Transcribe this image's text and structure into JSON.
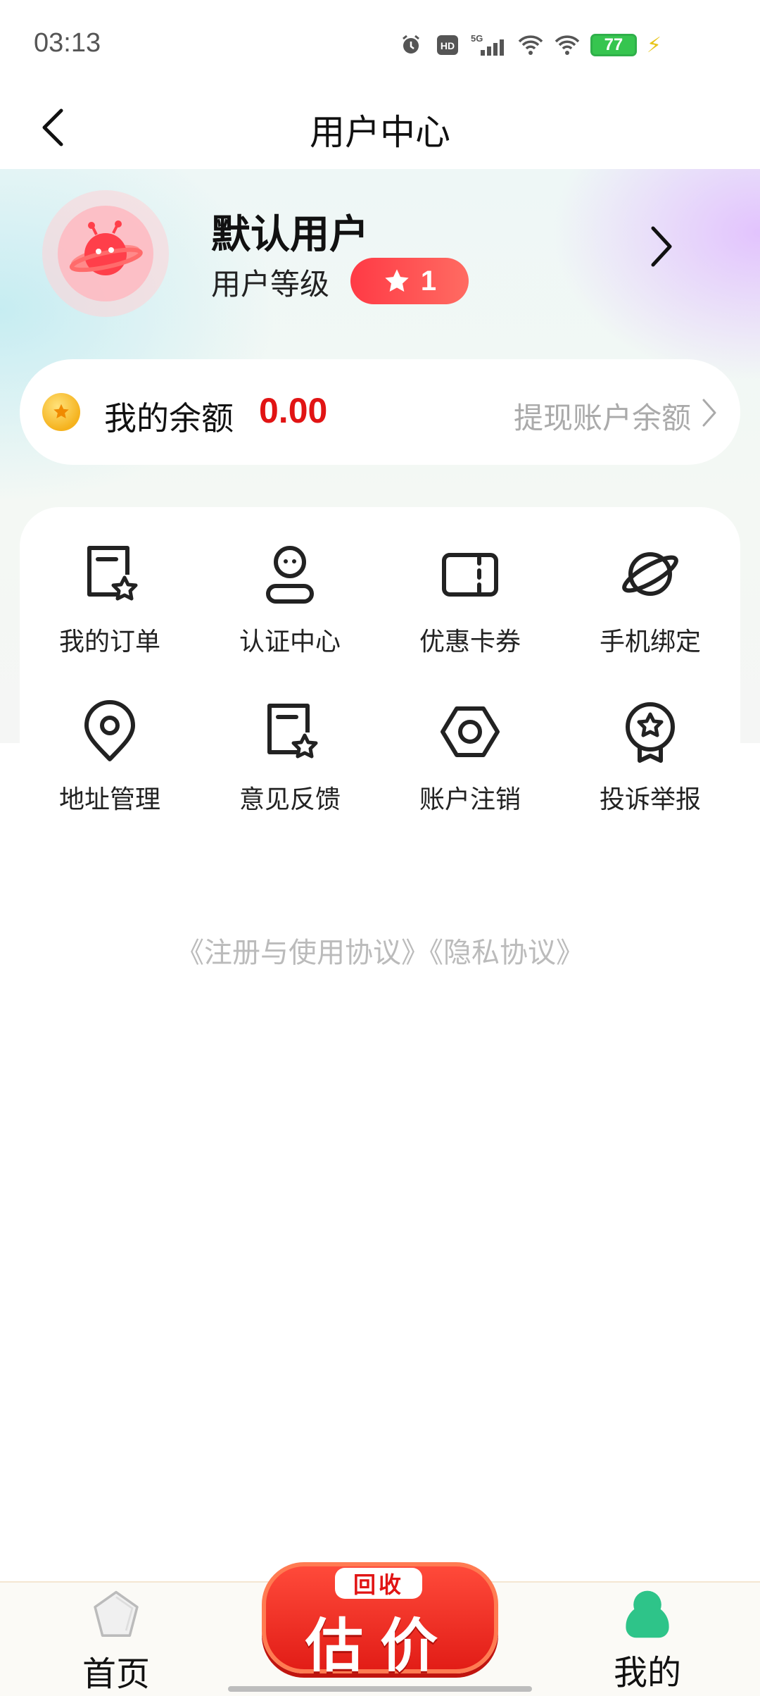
{
  "status_bar": {
    "time": "03:13",
    "network": "5G",
    "battery": "77"
  },
  "header": {
    "title": "用户中心"
  },
  "profile": {
    "name": "默认用户",
    "level_label": "用户等级",
    "level": "1"
  },
  "balance": {
    "label": "我的余额",
    "amount": "0.00",
    "withdraw_label": "提现账户余额"
  },
  "menu": {
    "items": [
      {
        "label": "我的订单",
        "icon": "order-star-icon"
      },
      {
        "label": "认证中心",
        "icon": "person-icon"
      },
      {
        "label": "优惠卡券",
        "icon": "ticket-icon"
      },
      {
        "label": "手机绑定",
        "icon": "planet-icon"
      },
      {
        "label": "地址管理",
        "icon": "location-pin-icon"
      },
      {
        "label": "意见反馈",
        "icon": "feedback-star-icon"
      },
      {
        "label": "账户注销",
        "icon": "hexagon-nut-icon"
      },
      {
        "label": "投诉举报",
        "icon": "award-badge-icon"
      }
    ]
  },
  "agreements": "《注册与使用协议》《隐私协议》",
  "tab_bar": {
    "home_label": "首页",
    "estimate_tag": "回收",
    "estimate_label": "估价",
    "mine_label": "我的"
  },
  "colors": {
    "accent_red": "#e11414",
    "badge_red": "#ff3a45",
    "mine_green": "#2ec489"
  }
}
